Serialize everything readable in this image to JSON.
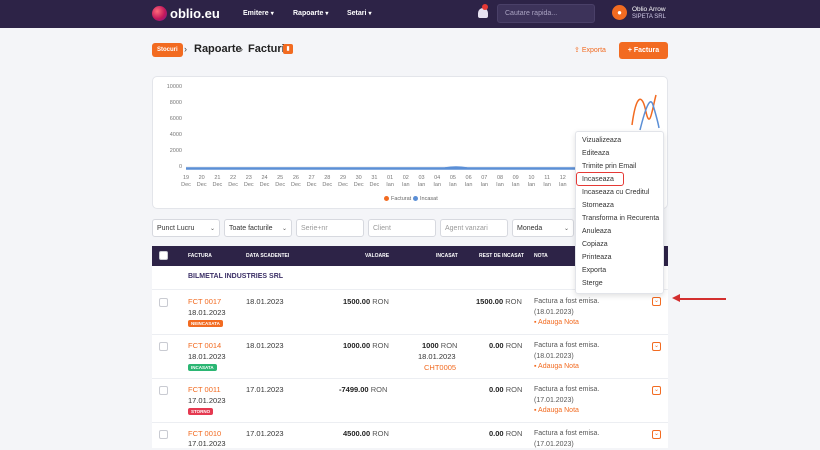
{
  "topbar": {
    "logo_text": "oblio.eu",
    "nav": [
      "Emitere",
      "Rapoarte",
      "Setari"
    ],
    "search_placeholder": "Cautare rapida...",
    "user_initial": "",
    "user_name": "Oblio Arrow",
    "user_company": "SIPETA SRL"
  },
  "breadcrumb": {
    "badge": "Stocuri",
    "section": "Rapoarte",
    "page": "Facturi"
  },
  "actions": {
    "export": "Exporta",
    "factura": "+ Factura"
  },
  "chart_data": {
    "type": "line",
    "y_ticks": [
      "10000",
      "8000",
      "6000",
      "4000",
      "2000",
      "0"
    ],
    "x_ticks": [
      [
        "19",
        "Dec"
      ],
      [
        "20",
        "Dec"
      ],
      [
        "21",
        "Dec"
      ],
      [
        "22",
        "Dec"
      ],
      [
        "23",
        "Dec"
      ],
      [
        "24",
        "Dec"
      ],
      [
        "25",
        "Dec"
      ],
      [
        "26",
        "Dec"
      ],
      [
        "27",
        "Dec"
      ],
      [
        "28",
        "Dec"
      ],
      [
        "29",
        "Dec"
      ],
      [
        "30",
        "Dec"
      ],
      [
        "31",
        "Dec"
      ],
      [
        "01",
        "Ian"
      ],
      [
        "02",
        "Ian"
      ],
      [
        "03",
        "Ian"
      ],
      [
        "04",
        "Ian"
      ],
      [
        "05",
        "Ian"
      ],
      [
        "06",
        "Ian"
      ],
      [
        "07",
        "Ian"
      ],
      [
        "08",
        "Ian"
      ],
      [
        "09",
        "Ian"
      ],
      [
        "10",
        "Ian"
      ],
      [
        "11",
        "Ian"
      ],
      [
        "12",
        "Ian"
      ]
    ],
    "ylim": [
      0,
      10000
    ],
    "series": [
      {
        "name": "Facturat",
        "color": "#f26b21"
      },
      {
        "name": "Incasat",
        "color": "#5b8fd6"
      }
    ]
  },
  "filters": {
    "punct_lucru": "Punct Lucru",
    "toate_facturile": "Toate facturile",
    "serie_nr": "Serie+nr",
    "client": "Client",
    "agent": "Agent vanzari",
    "moneda": "Moneda"
  },
  "table": {
    "headers": [
      "FACTURA",
      "DATA SCADENTEI",
      "VALOARE",
      "INCASAT",
      "REST DE INCASAT",
      "NOTA"
    ],
    "group": "BILMETAL INDUSTRIES SRL",
    "rows": [
      {
        "nr": "FCT 0017",
        "date": "18.01.2023",
        "tag": "NEINCASATA",
        "tag_color": "#f26b21",
        "scad": "18.01.2023",
        "valoare": "1500.00",
        "incasat": "",
        "incasat_date": "",
        "incasat_ref": "",
        "rest": "1500.00",
        "nota": "Factura a fost emisa.",
        "nota_date": "(18.01.2023)",
        "add": "Adauga Nota"
      },
      {
        "nr": "FCT 0014",
        "date": "18.01.2023",
        "tag": "INCASATA",
        "tag_color": "#2bb673",
        "scad": "18.01.2023",
        "valoare": "1000.00",
        "incasat": "1000",
        "incasat_date": "18.01.2023",
        "incasat_ref": "CHT0005",
        "rest": "0.00",
        "nota": "Factura a fost emisa.",
        "nota_date": "(18.01.2023)",
        "add": "Adauga Nota"
      },
      {
        "nr": "FCT 0011",
        "date": "17.01.2023",
        "tag": "STORNO",
        "tag_color": "#e53950",
        "scad": "17.01.2023",
        "valoare": "-7499.00",
        "incasat": "",
        "incasat_date": "",
        "incasat_ref": "",
        "rest": "0.00",
        "nota": "Factura a fost emisa.",
        "nota_date": "(17.01.2023)",
        "add": "Adauga Nota"
      },
      {
        "nr": "FCT 0010",
        "date": "17.01.2023",
        "tag": "",
        "tag_color": "",
        "scad": "17.01.2023",
        "valoare": "4500.00",
        "incasat": "",
        "incasat_date": "",
        "incasat_ref": "",
        "rest": "0.00",
        "nota": "Factura a fost emisa.",
        "nota_date": "(17.01.2023)",
        "add": ""
      }
    ],
    "currency": "RON"
  },
  "context_menu": {
    "items": [
      "Vizualizeaza",
      "Editeaza",
      "Trimite prin Email",
      "Incaseaza",
      "Incaseaza cu Creditul",
      "Storneaza",
      "Transforma in Recurenta",
      "Anuleaza",
      "Copiaza",
      "Printeaza",
      "Exporta",
      "Sterge"
    ],
    "highlighted": "Incaseaza"
  }
}
